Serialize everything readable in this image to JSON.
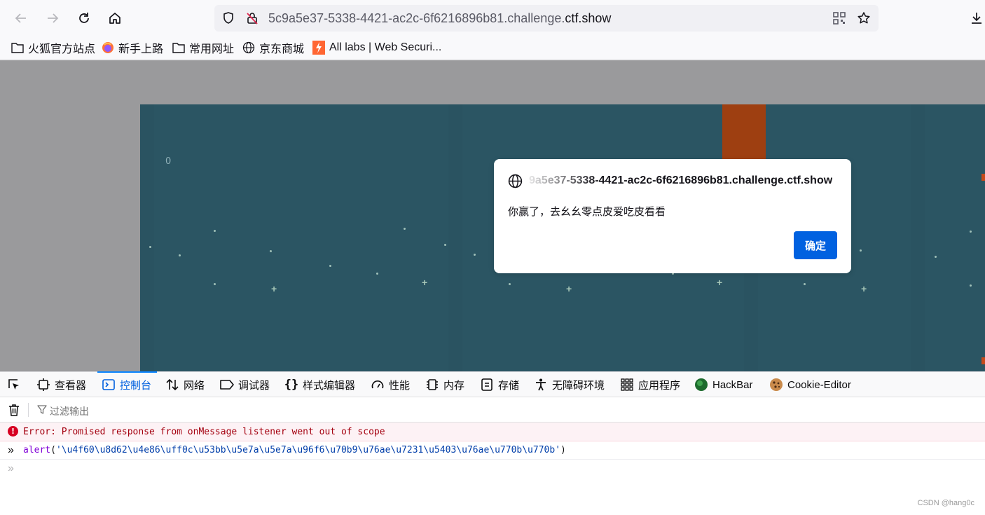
{
  "browser": {
    "url_prefix": "5c9a5e37-5338-4421-ac2c-6f6216896b81.challenge.",
    "url_domain": "ctf.show"
  },
  "bookmarks": [
    {
      "label": "火狐官方站点",
      "icon": "folder-icon"
    },
    {
      "label": "新手上路",
      "icon": "firefox-icon"
    },
    {
      "label": "常用网址",
      "icon": "folder-icon"
    },
    {
      "label": "京东商城",
      "icon": "globe-icon"
    },
    {
      "label": "All labs | Web Securi...",
      "icon": "portswigger-icon"
    }
  ],
  "game": {
    "score": "0"
  },
  "dialog": {
    "origin": "9a5e37-5338-4421-ac2c-6f6216896b81.challenge.ctf.show",
    "message": "你赢了，去幺幺零点皮爱吃皮看看",
    "ok_label": "确定"
  },
  "devtools": {
    "tabs": [
      {
        "label": "查看器",
        "icon": "inspector-icon"
      },
      {
        "label": "控制台",
        "icon": "console-icon",
        "active": true
      },
      {
        "label": "网络",
        "icon": "network-icon"
      },
      {
        "label": "调试器",
        "icon": "debugger-icon"
      },
      {
        "label": "样式编辑器",
        "icon": "style-editor-icon"
      },
      {
        "label": "性能",
        "icon": "performance-icon"
      },
      {
        "label": "内存",
        "icon": "memory-icon"
      },
      {
        "label": "存储",
        "icon": "storage-icon"
      },
      {
        "label": "无障碍环境",
        "icon": "accessibility-icon"
      },
      {
        "label": "应用程序",
        "icon": "application-icon"
      },
      {
        "label": "HackBar",
        "icon": "hackbar-icon"
      },
      {
        "label": "Cookie-Editor",
        "icon": "cookie-icon"
      }
    ],
    "filter_placeholder": "过滤输出",
    "error_message": "Error: Promised response from onMessage listener went out of scope",
    "command": {
      "fn": "alert",
      "open": "(",
      "arg": "'\\u4f60\\u8d62\\u4e86\\uff0c\\u53bb\\u5e7a\\u5e7a\\u96f6\\u70b9\\u76ae\\u7231\\u5403\\u76ae\\u770b\\u770b'",
      "close": ")"
    }
  },
  "watermark": "CSDN @hang0c"
}
